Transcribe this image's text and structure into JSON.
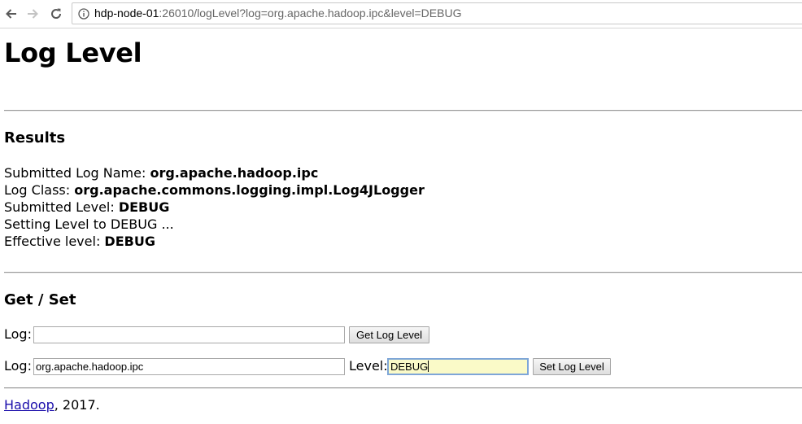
{
  "browser": {
    "url_host": "hdp-node-01",
    "url_rest": ":26010/logLevel?log=org.apache.hadoop.ipc&level=DEBUG",
    "back_icon": "arrow-left-icon",
    "forward_icon": "arrow-right-icon",
    "reload_icon": "reload-icon",
    "info_icon": "info-icon"
  },
  "page": {
    "title": "Log Level"
  },
  "results": {
    "heading": "Results",
    "submitted_log_name_label": "Submitted Log Name: ",
    "submitted_log_name_value": "org.apache.hadoop.ipc",
    "log_class_label": "Log Class: ",
    "log_class_value": "org.apache.commons.logging.impl.Log4JLogger",
    "submitted_level_label": "Submitted Level: ",
    "submitted_level_value": "DEBUG",
    "setting_level_text": "Setting Level to DEBUG ...",
    "effective_level_label": "Effective level: ",
    "effective_level_value": "DEBUG"
  },
  "getset": {
    "heading": "Get / Set",
    "get_form": {
      "log_label": "Log:",
      "log_value": "",
      "button_label": "Get Log Level"
    },
    "set_form": {
      "log_label": "Log:",
      "log_value": "org.apache.hadoop.ipc",
      "level_label": "Level:",
      "level_value": "DEBUG",
      "button_label": "Set Log Level"
    }
  },
  "footer": {
    "link_text": "Hadoop",
    "suffix": ", 2017."
  },
  "colors": {
    "link": "#1a0dab",
    "active_input_bg": "#fafac8",
    "active_input_border": "#7ea6d8"
  }
}
